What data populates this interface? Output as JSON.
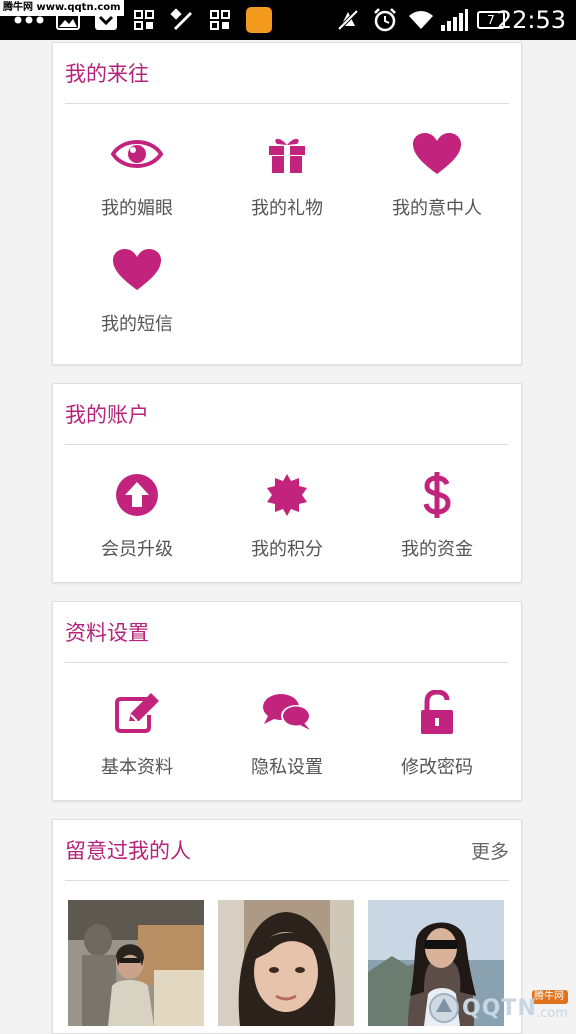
{
  "watermark_top": "腾牛网 www.qqtn.com",
  "status": {
    "time": "22:53",
    "battery": "7"
  },
  "sections": [
    {
      "title": "我的来往",
      "items": [
        {
          "label": "我的媚眼",
          "icon": "eye-icon"
        },
        {
          "label": "我的礼物",
          "icon": "gift-icon"
        },
        {
          "label": "我的意中人",
          "icon": "heart-icon"
        },
        {
          "label": "我的短信",
          "icon": "heart-icon"
        }
      ]
    },
    {
      "title": "我的账户",
      "items": [
        {
          "label": "会员升级",
          "icon": "arrow-up-circle-icon"
        },
        {
          "label": "我的积分",
          "icon": "badge-star-icon"
        },
        {
          "label": "我的资金",
          "icon": "dollar-icon"
        }
      ]
    },
    {
      "title": "资料设置",
      "items": [
        {
          "label": "基本资料",
          "icon": "edit-icon"
        },
        {
          "label": "隐私设置",
          "icon": "chat-bubbles-icon"
        },
        {
          "label": "修改密码",
          "icon": "unlock-icon"
        }
      ]
    },
    {
      "title": "留意过我的人",
      "more": "更多"
    }
  ],
  "watermark_bottom": {
    "brand": "QQTN",
    "tag": "腾牛网",
    "suffix": ".com"
  },
  "colors": {
    "accent": "#c2247d",
    "title": "#b5237b"
  }
}
